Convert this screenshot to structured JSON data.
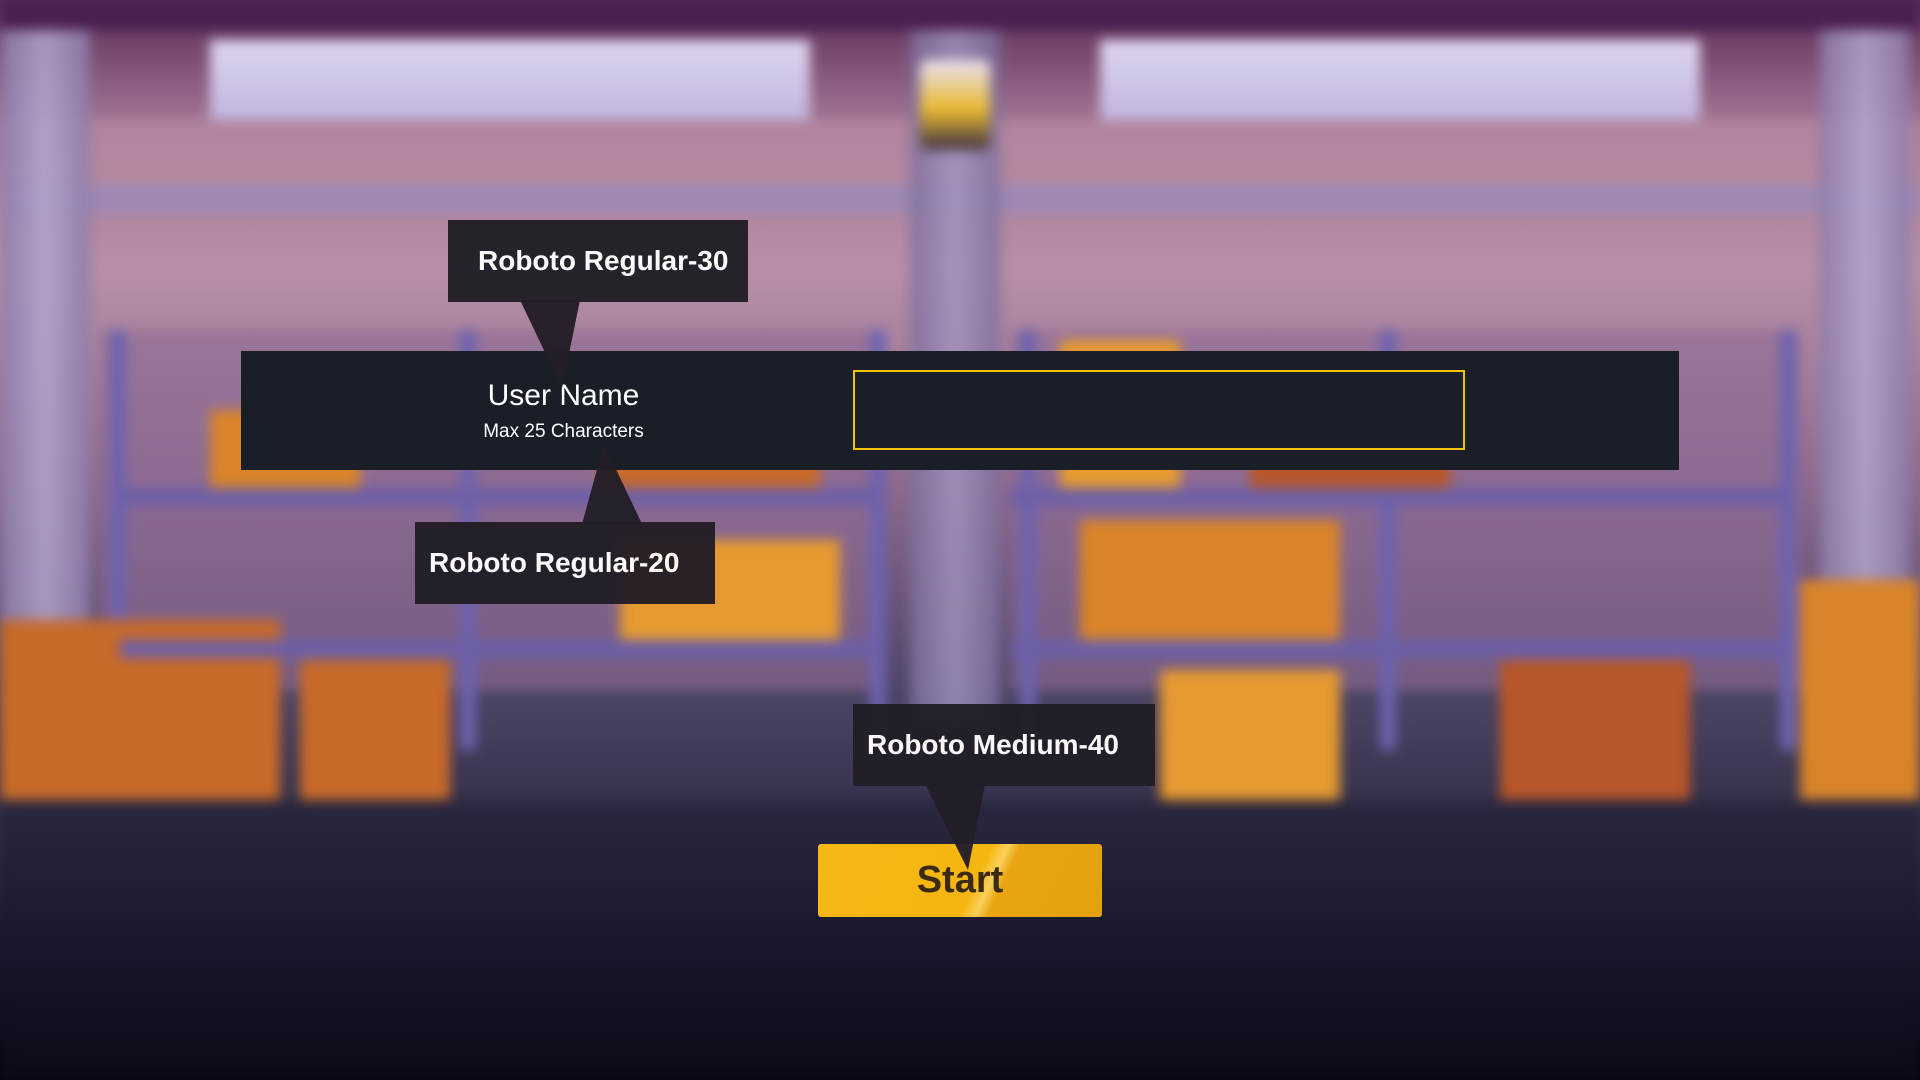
{
  "form": {
    "username_label": "User Name",
    "username_hint": "Max 25 Characters",
    "username_value": ""
  },
  "actions": {
    "start_label": "Start"
  },
  "annotations": {
    "label_font": "Roboto Regular-30",
    "hint_font": "Roboto Regular-20",
    "button_font": "Roboto Medium-40"
  },
  "colors": {
    "panel_bg": "#1a1f27",
    "input_border": "#f2c200",
    "button_bg": "#f5b814",
    "button_text": "#3a2a12",
    "callout_bg": "#221d26"
  }
}
